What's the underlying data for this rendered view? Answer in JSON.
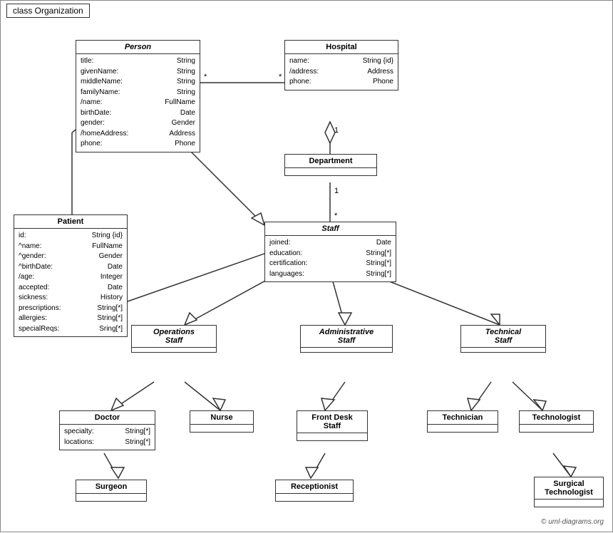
{
  "title": "class Organization",
  "copyright": "© uml-diagrams.org",
  "classes": {
    "person": {
      "name": "Person",
      "italic": true,
      "attributes": [
        [
          "title:",
          "String"
        ],
        [
          "givenName:",
          "String"
        ],
        [
          "middleName:",
          "String"
        ],
        [
          "familyName:",
          "String"
        ],
        [
          "/name:",
          "FullName"
        ],
        [
          "birthDate:",
          "Date"
        ],
        [
          "gender:",
          "Gender"
        ],
        [
          "/homeAddress:",
          "Address"
        ],
        [
          "phone:",
          "Phone"
        ]
      ]
    },
    "hospital": {
      "name": "Hospital",
      "italic": false,
      "attributes": [
        [
          "name:",
          "String {id}"
        ],
        [
          "/address:",
          "Address"
        ],
        [
          "phone:",
          "Phone"
        ]
      ]
    },
    "patient": {
      "name": "Patient",
      "italic": false,
      "attributes": [
        [
          "id:",
          "String {id}"
        ],
        [
          "^name:",
          "FullName"
        ],
        [
          "^gender:",
          "Gender"
        ],
        [
          "^birthDate:",
          "Date"
        ],
        [
          "/age:",
          "Integer"
        ],
        [
          "accepted:",
          "Date"
        ],
        [
          "sickness:",
          "History"
        ],
        [
          "prescriptions:",
          "String[*]"
        ],
        [
          "allergies:",
          "String[*]"
        ],
        [
          "specialReqs:",
          "Sring[*]"
        ]
      ]
    },
    "department": {
      "name": "Department",
      "italic": false,
      "attributes": []
    },
    "staff": {
      "name": "Staff",
      "italic": true,
      "attributes": [
        [
          "joined:",
          "Date"
        ],
        [
          "education:",
          "String[*]"
        ],
        [
          "certification:",
          "String[*]"
        ],
        [
          "languages:",
          "String[*]"
        ]
      ]
    },
    "operationsStaff": {
      "name": "Operations\nStaff",
      "italic": true,
      "attributes": []
    },
    "administrativeStaff": {
      "name": "Administrative\nStaff",
      "italic": true,
      "attributes": []
    },
    "technicalStaff": {
      "name": "Technical\nStaff",
      "italic": true,
      "attributes": []
    },
    "doctor": {
      "name": "Doctor",
      "italic": false,
      "attributes": [
        [
          "specialty:",
          "String[*]"
        ],
        [
          "locations:",
          "String[*]"
        ]
      ]
    },
    "nurse": {
      "name": "Nurse",
      "italic": false,
      "attributes": []
    },
    "frontDeskStaff": {
      "name": "Front Desk\nStaff",
      "italic": false,
      "attributes": []
    },
    "technician": {
      "name": "Technician",
      "italic": false,
      "attributes": []
    },
    "technologist": {
      "name": "Technologist",
      "italic": false,
      "attributes": []
    },
    "surgeon": {
      "name": "Surgeon",
      "italic": false,
      "attributes": []
    },
    "receptionist": {
      "name": "Receptionist",
      "italic": false,
      "attributes": []
    },
    "surgicalTechnologist": {
      "name": "Surgical\nTechnologist",
      "italic": false,
      "attributes": []
    }
  }
}
